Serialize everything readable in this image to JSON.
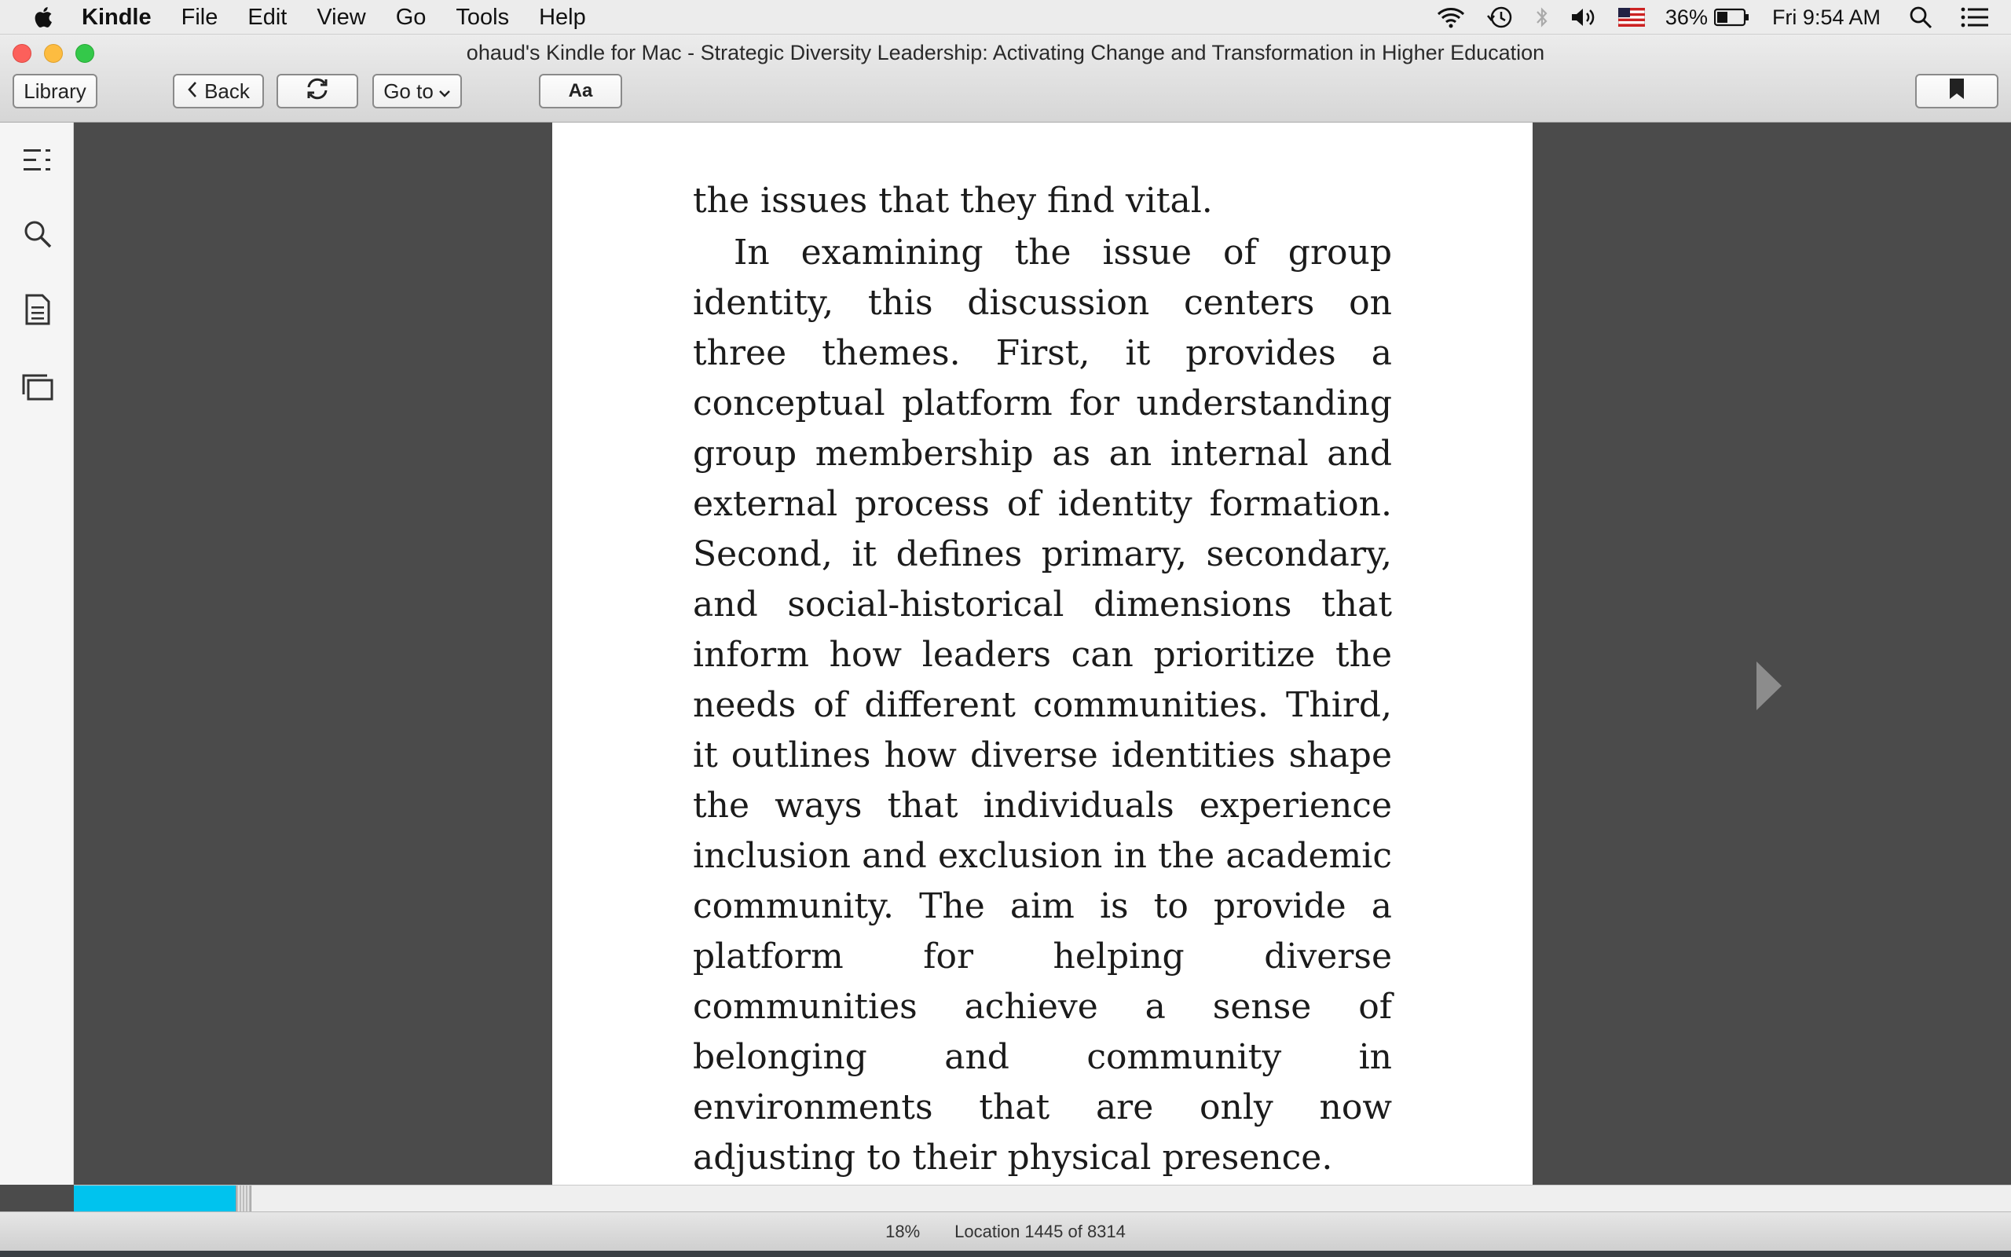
{
  "menubar": {
    "app_name": "Kindle",
    "items": [
      "File",
      "Edit",
      "View",
      "Go",
      "Tools",
      "Help"
    ],
    "battery_percent": "36%",
    "clock": "Fri 9:54 AM",
    "icons": [
      "apple-icon",
      "wifi-icon",
      "time-machine-icon",
      "bluetooth-icon",
      "volume-icon",
      "us-flag-icon",
      "battery-icon",
      "spotlight-icon",
      "notification-center-icon"
    ]
  },
  "window": {
    "title": "ohaud's Kindle for Mac - Strategic Diversity Leadership: Activating Change and Transformation in Higher Education"
  },
  "toolbar": {
    "library_label": "Library",
    "back_label": "Back",
    "goto_label": "Go to",
    "font_label": "Aa",
    "icons": [
      "chevron-left-icon",
      "sync-icon",
      "chevron-down-icon",
      "bookmark-icon"
    ]
  },
  "sidebar": {
    "icons": [
      "table-of-contents-icon",
      "search-icon",
      "notes-icon",
      "flashcards-icon"
    ]
  },
  "book": {
    "carryover": "the issues that they find vital.",
    "paragraph": "In examining the issue of group identity, this discussion centers on three themes. First, it provides a conceptual platform for understanding group membership as an internal and external process of identity formation. Second, it defines primary, secondary, and social-historical dimensions that inform how leaders can prioritize the needs of different communities. Third, it outlines how diverse identities shape the ways that individuals experience inclusion and exclusion in the academic community. The aim is to provide a platform for helping diverse communities achieve a sense of belonging and community in environments that are only now adjusting to their physical presence."
  },
  "progress": {
    "fraction": 0.18,
    "accent_color": "#00c3ee"
  },
  "statusbar": {
    "percent": "18%",
    "location": "Location 1445 of 8314"
  }
}
